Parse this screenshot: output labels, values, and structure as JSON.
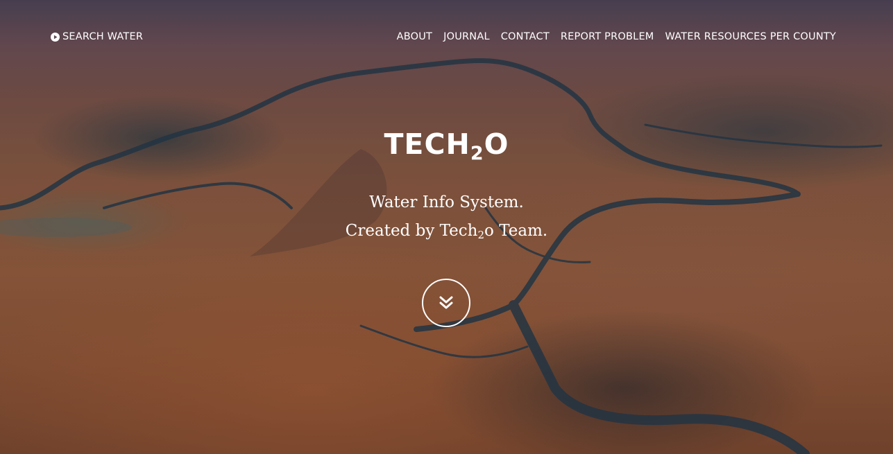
{
  "nav": {
    "brand_icon": "play-circle-icon",
    "brand_label": "SEARCH WATER",
    "links": [
      {
        "label": "ABOUT"
      },
      {
        "label": "JOURNAL"
      },
      {
        "label": "CONTACT"
      },
      {
        "label": "REPORT PROBLEM"
      },
      {
        "label": "WATER RESOURCES PER COUNTY"
      }
    ]
  },
  "hero": {
    "title_main": "TECH",
    "title_sub": "2",
    "title_end": "O",
    "line1": "Water Info System.",
    "line2_prefix": "Created by Tech",
    "line2_sub": "2",
    "line2_suffix": "o Team.",
    "scroll_icon": "double-chevron-down-icon"
  },
  "colors": {
    "text": "#ffffff",
    "terrain": "#8a5b42",
    "water": "#24384a"
  }
}
